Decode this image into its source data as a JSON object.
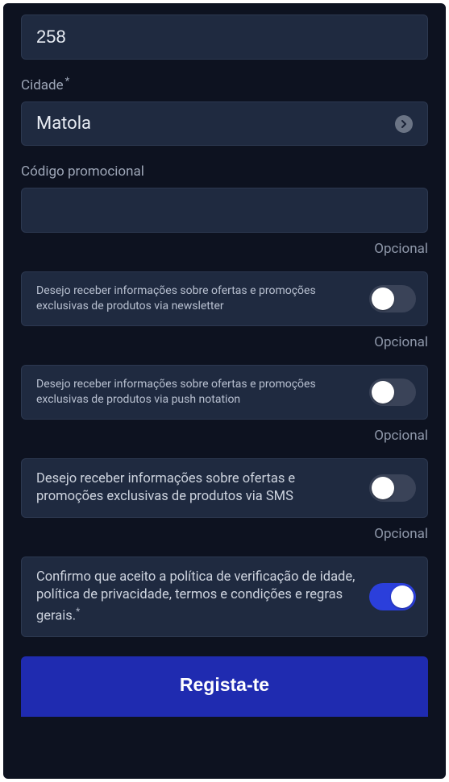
{
  "phone_prefix": {
    "value": "258"
  },
  "city": {
    "label": "Cidade",
    "value": "Matola",
    "required_mark": "*"
  },
  "promo": {
    "label": "Código promocional",
    "value": "",
    "hint": "Opcional"
  },
  "toggles": [
    {
      "text": "Desejo receber informações sobre ofertas e promoções exclusivas de produtos via newsletter",
      "on": false,
      "hint": "Opcional"
    },
    {
      "text": "Desejo receber informações sobre ofertas e promoções exclusivas de produtos via push notation",
      "on": false,
      "hint": "Opcional"
    },
    {
      "text": "Desejo receber informações sobre ofertas e promoções exclusivas de produtos via SMS",
      "on": false,
      "hint": "Opcional",
      "big": true
    },
    {
      "text": "Confirmo que aceito a política de verificação de idade, política de privacidade, termos e condições e regras gerais.",
      "on": true,
      "big": true,
      "required": true
    }
  ],
  "register_label": "Regista-te"
}
